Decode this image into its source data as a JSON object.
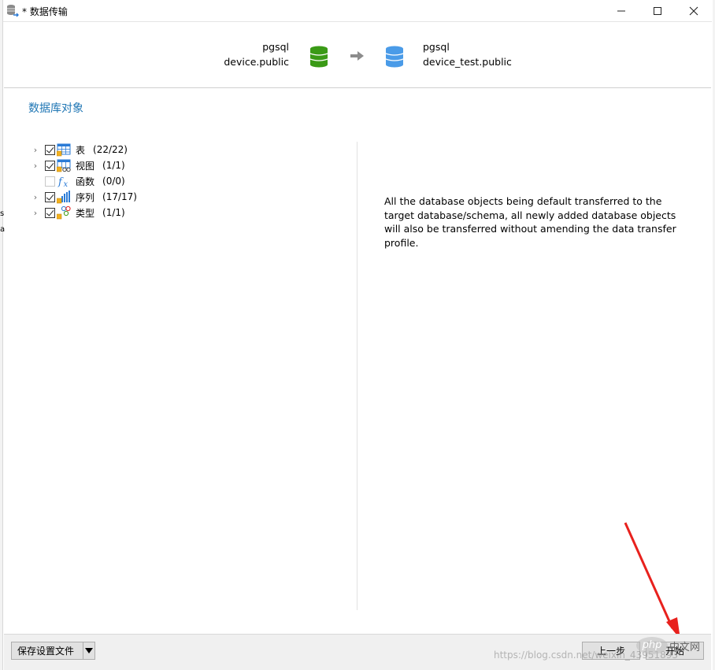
{
  "window": {
    "title": "* 数据传输"
  },
  "transfer": {
    "source_name": "pgsql",
    "source_schema": "device.public",
    "target_name": "pgsql",
    "target_schema": "device_test.public"
  },
  "section": {
    "title": "数据库对象"
  },
  "tree": [
    {
      "label": "表",
      "count": "(22/22)",
      "checked": true,
      "expandable": true,
      "icon": "table-icon"
    },
    {
      "label": "视图",
      "count": "(1/1)",
      "checked": true,
      "expandable": true,
      "icon": "view-icon"
    },
    {
      "label": "函数",
      "count": "(0/0)",
      "checked": false,
      "expandable": false,
      "icon": "function-icon"
    },
    {
      "label": "序列",
      "count": "(17/17)",
      "checked": true,
      "expandable": true,
      "icon": "sequence-icon"
    },
    {
      "label": "类型",
      "count": "(1/1)",
      "checked": true,
      "expandable": true,
      "icon": "type-icon"
    }
  ],
  "description": "All the database objects being default transferred to the target database/schema, all newly added database objects will also be transferred without amending the data transfer profile.",
  "buttons": {
    "save_profile": "保存设置文件",
    "back": "上一步",
    "start": "开始"
  },
  "watermarks": {
    "php_logo": "php",
    "php_cn": "中文网",
    "csdn": "https://blog.csdn.net/weixin_43951893"
  },
  "colors": {
    "source_db": "#3a9a16",
    "target_db": "#4a9be8",
    "section_title": "#1f76b4",
    "annotation_arrow": "#e8211d"
  }
}
